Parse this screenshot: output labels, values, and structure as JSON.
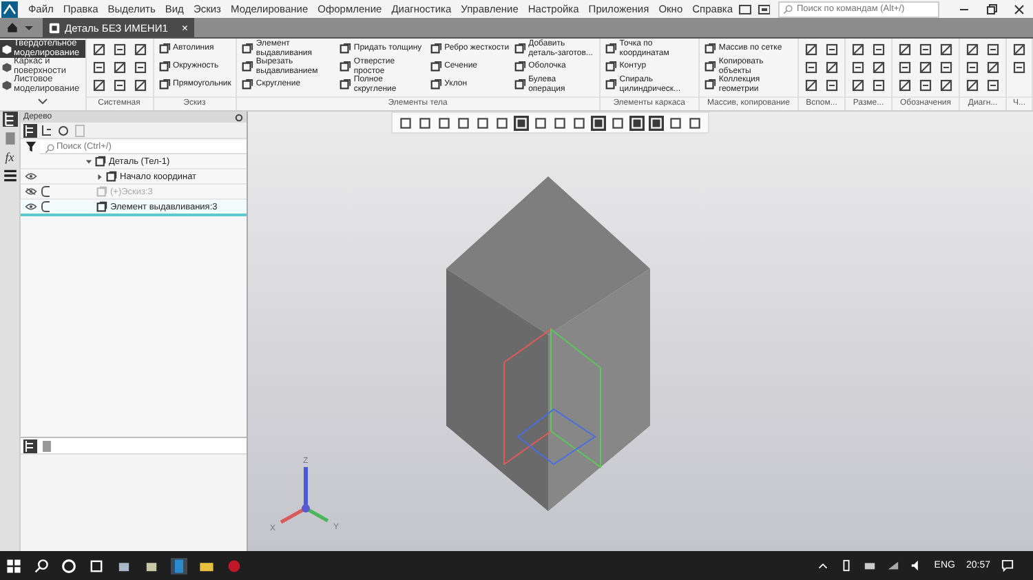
{
  "menu": [
    "Файл",
    "Правка",
    "Выделить",
    "Вид",
    "Эскиз",
    "Моделирование",
    "Оформление",
    "Диагностика",
    "Управление",
    "Настройка",
    "Приложения",
    "Окно",
    "Справка"
  ],
  "command_search": {
    "placeholder": "Поиск по командам (Alt+/)"
  },
  "document_tab": {
    "title": "Деталь БЕЗ ИМЕНИ1",
    "close": "×"
  },
  "modes": [
    {
      "label": "Твердотельное моделирование",
      "selected": true
    },
    {
      "label": "Каркас и поверхности",
      "selected": false
    },
    {
      "label": "Листовое моделирование",
      "selected": false
    }
  ],
  "ribbon_groups": [
    {
      "label": "Системная",
      "kind": "icons"
    },
    {
      "label": "Эскиз",
      "kind": "commands",
      "commands": [
        "Автолиния",
        "Окружность",
        "Прямоугольник"
      ]
    },
    {
      "label": "Элементы тела",
      "kind": "commands",
      "commands": [
        "Элемент выдавливания",
        "Вырезать выдавливанием",
        "Скругление",
        "Придать толщину",
        "Отверстие простое",
        "Полное скругление",
        "Ребро жесткости",
        "Сечение",
        "Уклон",
        "Добавить деталь-заготов...",
        "Оболочка",
        "Булева операция"
      ]
    },
    {
      "label": "Элементы каркаса",
      "kind": "commands",
      "commands": [
        "Точка по координатам",
        "Контур",
        "Спираль цилиндрическ..."
      ]
    },
    {
      "label": "Массив, копирование",
      "kind": "commands",
      "commands": [
        "Массив по сетке",
        "Копировать объекты",
        "Коллекция геометрии"
      ]
    },
    {
      "label": "Вспом...",
      "kind": "icons"
    },
    {
      "label": "Разме...",
      "kind": "icons"
    },
    {
      "label": "Обозначения",
      "kind": "icons"
    },
    {
      "label": "Диагн...",
      "kind": "icons"
    },
    {
      "label": "Ч...",
      "kind": "icons"
    }
  ],
  "side_strip": {
    "formula_icon": "fx"
  },
  "tree": {
    "title": "Дерево",
    "search_placeholder": "Поиск (Ctrl+/)",
    "items": [
      {
        "label": "Деталь (Тел-1)",
        "expanded": true,
        "selected": false,
        "children": [
          {
            "label": "Начало координат",
            "expanded": false,
            "visible": true,
            "selected": false
          },
          {
            "label": "(+)Эскиз:3",
            "visible": false,
            "selected": false
          },
          {
            "label": "Элемент выдавливания:3",
            "visible": true,
            "selected": true
          }
        ]
      }
    ]
  },
  "triad": {
    "z": "Z",
    "x": "X",
    "y": "Y"
  },
  "taskbar": {
    "language": "ENG",
    "time": "20:57"
  }
}
